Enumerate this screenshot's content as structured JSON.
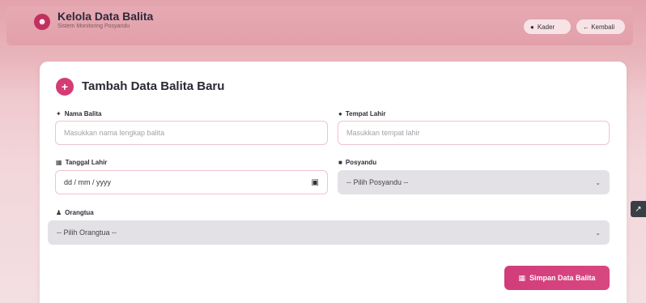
{
  "header": {
    "title": "Kelola Data Balita",
    "subtitle": "Sistem Monitoring Posyandu",
    "kader_label": "Kader",
    "kembali_label": "← Kembali",
    "logo_icon": "baby-icon",
    "kader_icon": "user-circle-icon"
  },
  "form": {
    "title": "Tambah Data Balita Baru",
    "nama": {
      "label": "Nama Balita",
      "placeholder": "Masukkan nama lengkap balita",
      "icon": "child-icon"
    },
    "tempat": {
      "label": "Tempat Lahir",
      "placeholder": "Masukkan tempat lahir",
      "icon": "map-pin-icon"
    },
    "tanggal": {
      "label": "Tanggal Lahir",
      "value": "dd / mm / yyyy",
      "icon": "calendar-icon"
    },
    "posyandu": {
      "label": "Posyandu",
      "selected": "-- Pilih Posyandu --",
      "icon": "clinic-icon"
    },
    "orangtua": {
      "label": "Orangtua",
      "selected": "-- Pilih Orangtua --",
      "icon": "family-icon"
    },
    "save_label": "Simpan Data Balita",
    "save_icon": "floppy-disk-icon"
  },
  "colors": {
    "accent": "#d43c73",
    "header_bg": "#e2a0aa",
    "input_border": "#f0c3cf",
    "select_bg": "#e3e1e6"
  }
}
